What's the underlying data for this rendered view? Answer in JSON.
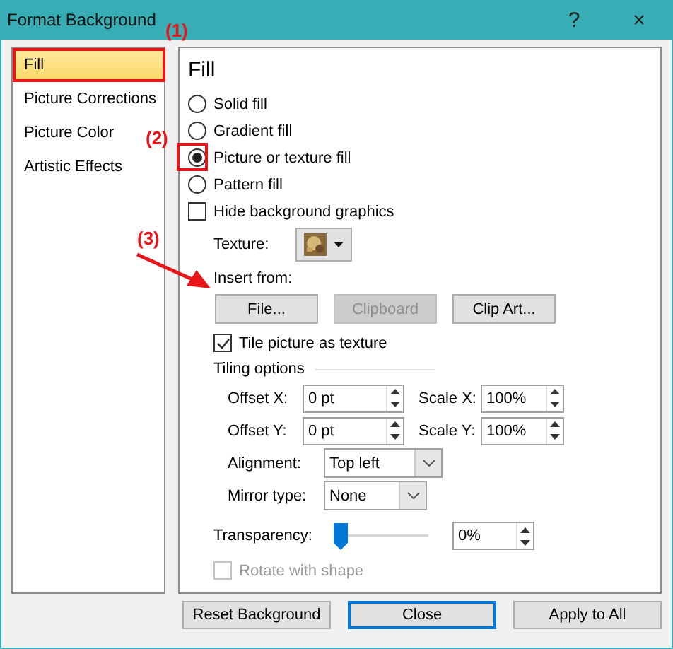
{
  "window": {
    "title": "Format Background",
    "help": "?",
    "close": "×"
  },
  "sidebar": {
    "items": [
      {
        "label": "Fill",
        "selected": true
      },
      {
        "label": "Picture Corrections",
        "selected": false
      },
      {
        "label": "Picture Color",
        "selected": false
      },
      {
        "label": "Artistic Effects",
        "selected": false
      }
    ]
  },
  "panel": {
    "heading": "Fill",
    "fill_options": [
      {
        "label": "Solid fill",
        "selected": false
      },
      {
        "label": "Gradient fill",
        "selected": false
      },
      {
        "label": "Picture or texture fill",
        "selected": true
      },
      {
        "label": "Pattern fill",
        "selected": false
      }
    ],
    "hide_background": {
      "label": "Hide background graphics",
      "checked": false
    },
    "texture": {
      "label": "Texture:"
    },
    "insert_from": {
      "label": "Insert from:",
      "buttons": [
        {
          "label": "File...",
          "disabled": false
        },
        {
          "label": "Clipboard",
          "disabled": true
        },
        {
          "label": "Clip Art...",
          "disabled": false
        }
      ]
    },
    "tile": {
      "label": "Tile picture as texture",
      "checked": true
    },
    "tiling_options": {
      "title": "Tiling options",
      "rows": [
        {
          "label": "Offset X:",
          "value": "0 pt",
          "scale_label": "Scale X:",
          "scale_value": "100%"
        },
        {
          "label": "Offset Y:",
          "value": "0 pt",
          "scale_label": "Scale Y:",
          "scale_value": "100%"
        }
      ],
      "alignment": {
        "label": "Alignment:",
        "value": "Top left"
      },
      "mirror": {
        "label": "Mirror type:",
        "value": "None"
      }
    },
    "transparency": {
      "label": "Transparency:",
      "level": 0,
      "value": "0%"
    },
    "rotate": {
      "label": "Rotate with shape",
      "checked": false,
      "disabled": true
    }
  },
  "buttons": [
    {
      "label": "Reset Background",
      "default": false
    },
    {
      "label": "Close",
      "default": true
    },
    {
      "label": "Apply to All",
      "default": false
    }
  ],
  "annotations": [
    {
      "label": "(1)"
    },
    {
      "label": "(2)"
    },
    {
      "label": "(3)"
    }
  ]
}
